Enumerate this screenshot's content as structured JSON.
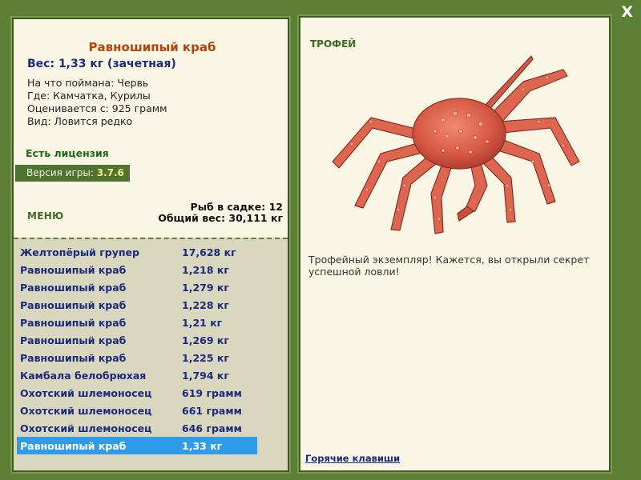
{
  "window": {
    "close_label": "X"
  },
  "fish": {
    "title": "Равношипый краб",
    "weight_line": "Вес: 1,33 кг (зачетная)",
    "info": [
      "На что поймана: Червь",
      "Где: Камчатка, Курилы",
      "Оценивается с: 925 грамм",
      "Вид: Ловится редко"
    ]
  },
  "license": "Есть лицензия",
  "version": {
    "prefix": "Версия игры: ",
    "value": "3.7.6"
  },
  "menu_label": "МЕНЮ",
  "cage": {
    "count_line": "Рыб в садке: 12",
    "weight_line": "Общий вес: 30,111 кг"
  },
  "catch_list": [
    {
      "name": "Желтопёрый групер",
      "weight": "17,628 кг"
    },
    {
      "name": "Равношипый краб",
      "weight": "1,218 кг"
    },
    {
      "name": "Равношипый краб",
      "weight": "1,279 кг"
    },
    {
      "name": "Равношипый краб",
      "weight": "1,228 кг"
    },
    {
      "name": "Равношипый краб",
      "weight": "1,21 кг"
    },
    {
      "name": "Равношипый краб",
      "weight": "1,269 кг"
    },
    {
      "name": "Равношипый краб",
      "weight": "1,225 кг"
    },
    {
      "name": "Камбала белобрюхая",
      "weight": "1,794 кг"
    },
    {
      "name": "Охотский шлемоносец",
      "weight": "619 грамм"
    },
    {
      "name": "Охотский шлемоносец",
      "weight": "661 грамм"
    },
    {
      "name": "Охотский шлемоносец",
      "weight": "646 грамм"
    },
    {
      "name": "Равношипый краб",
      "weight": "1,33 кг",
      "selected": true
    }
  ],
  "trophy": {
    "label": "ТРОФЕЙ",
    "text": "Трофейный экземпляр! Кажется, вы открыли секрет успешной ловли!",
    "image_icon": "king-crab-image"
  },
  "hotkeys_label": "Горячие клавиши",
  "colors": {
    "background": "#5d7e35",
    "panel": "#f9f6e5",
    "selected_row": "#2f9be9",
    "title": "#b4440a",
    "navy_text": "#1b2a7c",
    "green_label": "#3e6a1d"
  }
}
